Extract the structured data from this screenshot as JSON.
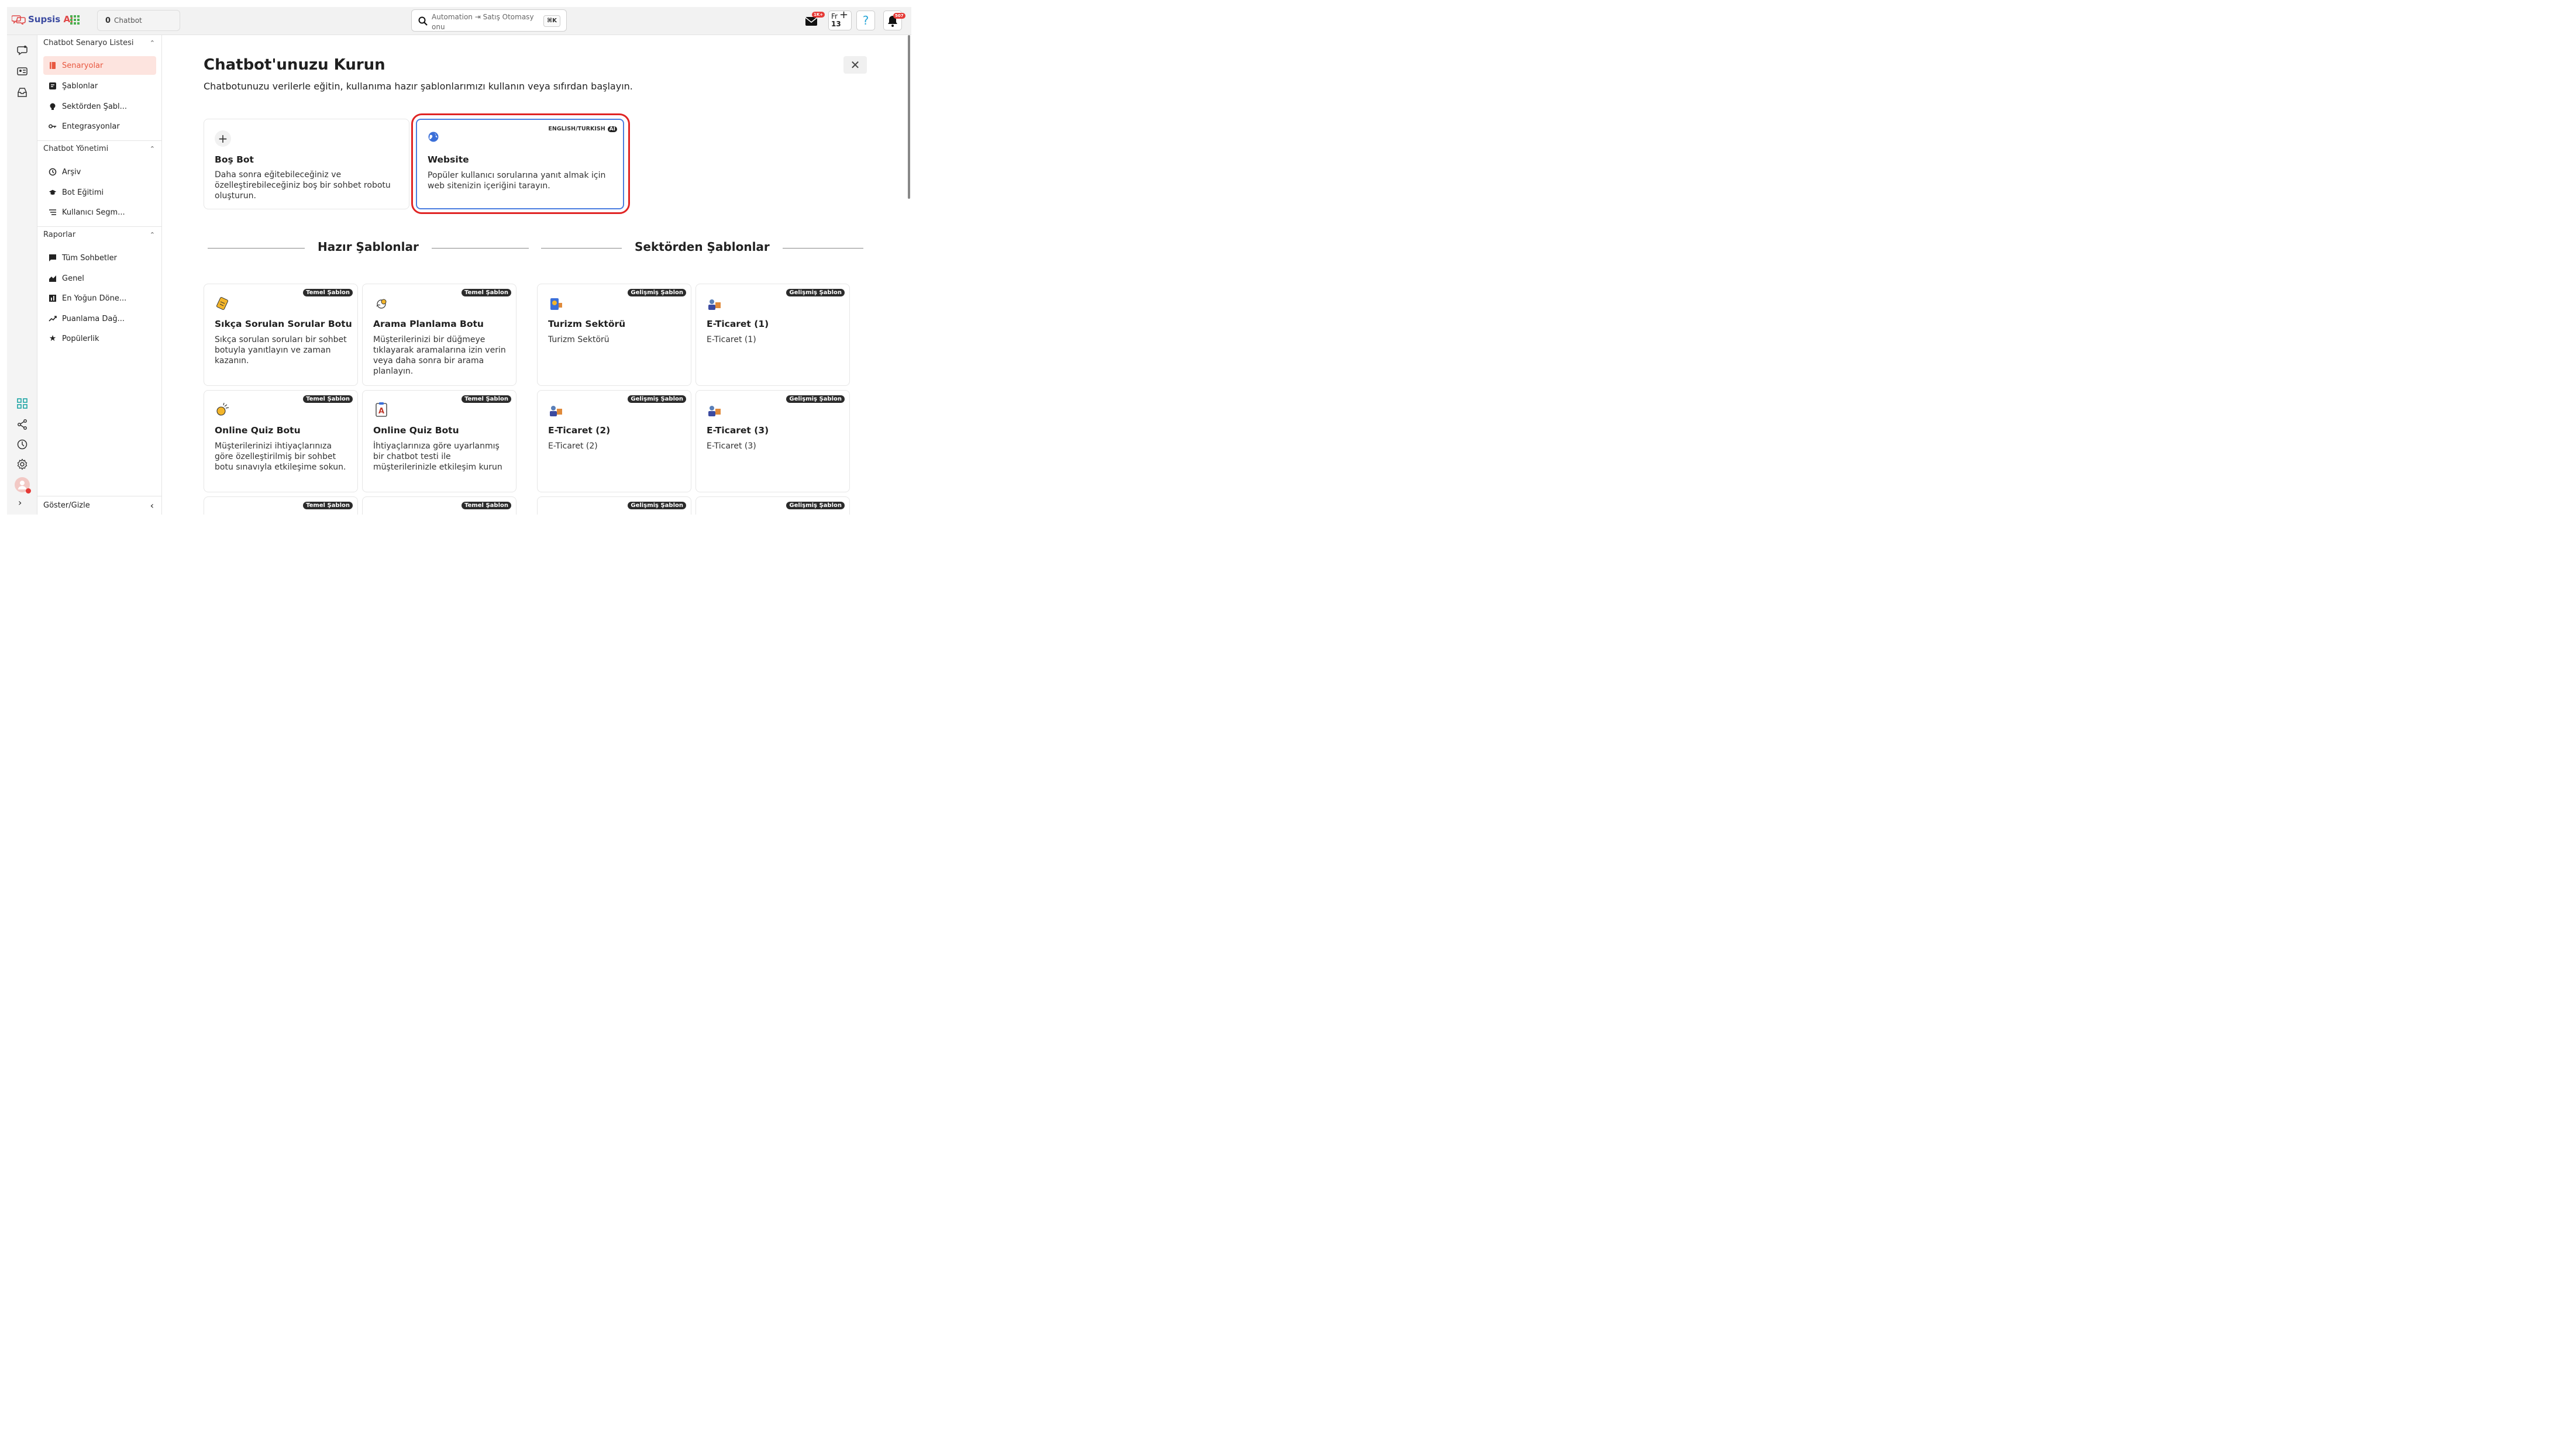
{
  "topbar": {
    "logo_main": "Supsis",
    "logo_accent": " Ai",
    "chatbot_count": "0",
    "chatbot_label": "Chatbot",
    "search_text": "Automation ⇥ Satış Otomasy onu",
    "search_shortcut": "⌘K",
    "mail_badge": "1K+",
    "fr_label": "Fr",
    "fr_day": "13",
    "help_label": "?",
    "bell_badge": "507"
  },
  "sidebar": {
    "sections": [
      {
        "title": "Chatbot Senaryo Listesi",
        "items": [
          {
            "label": "Senaryolar",
            "icon": "book-icon",
            "active": true
          },
          {
            "label": "Şablonlar",
            "icon": "template-icon"
          },
          {
            "label": "Sektörden Şabl...",
            "icon": "lightbulb-icon"
          },
          {
            "label": "Entegrasyonlar",
            "icon": "key-icon"
          }
        ]
      },
      {
        "title": "Chatbot Yönetimi",
        "items": [
          {
            "label": "Arşiv",
            "icon": "history-icon"
          },
          {
            "label": "Bot Eğitimi",
            "icon": "graduation-cap-icon"
          },
          {
            "label": "Kullanıcı Segm...",
            "icon": "segment-list-icon"
          }
        ]
      },
      {
        "title": "Raporlar",
        "items": [
          {
            "label": "Tüm Sohbetler",
            "icon": "chat-bubble-icon"
          },
          {
            "label": "Genel",
            "icon": "area-chart-icon"
          },
          {
            "label": "En Yoğun Döne...",
            "icon": "bar-chart-icon"
          },
          {
            "label": "Puanlama Dağ...",
            "icon": "trend-line-icon"
          },
          {
            "label": "Popülerlik",
            "icon": "star-icon"
          }
        ]
      }
    ],
    "footer_label": "Göster/Gizle"
  },
  "main": {
    "title": "Chatbot'unuzu Kurun",
    "subtitle": "Chatbotunuzu verilerle eğitin, kullanıma hazır şablonlarımızı kullanın veya sıfırdan başlayın.",
    "close_label": "✕",
    "blank_bot": {
      "title": "Boş Bot",
      "desc": "Daha sonra eğitebileceğiniz ve özelleştirebileceğiniz boş bir sohbet robotu oluşturun."
    },
    "website": {
      "title": "Website",
      "desc": "Popüler kullanıcı sorularına yanıt almak için web sitenizin içeriğini tarayın.",
      "lang_label": "ENGLISH/TURKISH",
      "ai_label": "AI"
    },
    "ready_heading": "Hazır Şablonlar",
    "sector_heading": "Sektörden Şablonlar",
    "ready_templates": [
      {
        "title": "Sıkça Sorulan Sorular Botu",
        "desc": "Sıkça sorulan soruları bir sohbet botuyla yanıtlayın ve zaman kazanın.",
        "tag": "Temel Şablon"
      },
      {
        "title": "Arama Planlama Botu",
        "desc": "Müşterilerinizi bir düğmeye tıklayarak aramalarına izin verin veya daha sonra bir arama planlayın.",
        "tag": "Temel Şablon"
      },
      {
        "title": "Online Quiz Botu",
        "desc": "Müşterilerinizi ihtiyaçlarınıza göre özelleştirilmiş bir sohbet botu sınavıyla etkileşime sokun.",
        "tag": "Temel Şablon"
      },
      {
        "title": "Online Quiz Botu",
        "desc": "İhtiyaçlarınıza göre uyarlanmış bir chatbot testi ile müşterilerinizle etkileşim kurun",
        "tag": "Temel Şablon"
      },
      {
        "title": "",
        "desc": "",
        "tag": "Temel Şablon"
      },
      {
        "title": "",
        "desc": "",
        "tag": "Temel Şablon"
      }
    ],
    "sector_templates": [
      {
        "title": "Turizm Sektörü",
        "desc": "Turizm Sektörü",
        "tag": "Gelişmiş Şablon"
      },
      {
        "title": "E-Ticaret (1)",
        "desc": "E-Ticaret (1)",
        "tag": "Gelişmiş Şablon"
      },
      {
        "title": "E-Ticaret (2)",
        "desc": "E-Ticaret (2)",
        "tag": "Gelişmiş Şablon"
      },
      {
        "title": "E-Ticaret (3)",
        "desc": "E-Ticaret (3)",
        "tag": "Gelişmiş Şablon"
      },
      {
        "title": "",
        "desc": "",
        "tag": "Gelişmiş Şablon"
      },
      {
        "title": "",
        "desc": "",
        "tag": "Gelişmiş Şablon"
      }
    ]
  },
  "colors": {
    "accent": "#e8573f",
    "active_bg": "#fde4df",
    "highlight": "#e02424",
    "website_border": "#4a7de0",
    "badge": "#e53935"
  }
}
